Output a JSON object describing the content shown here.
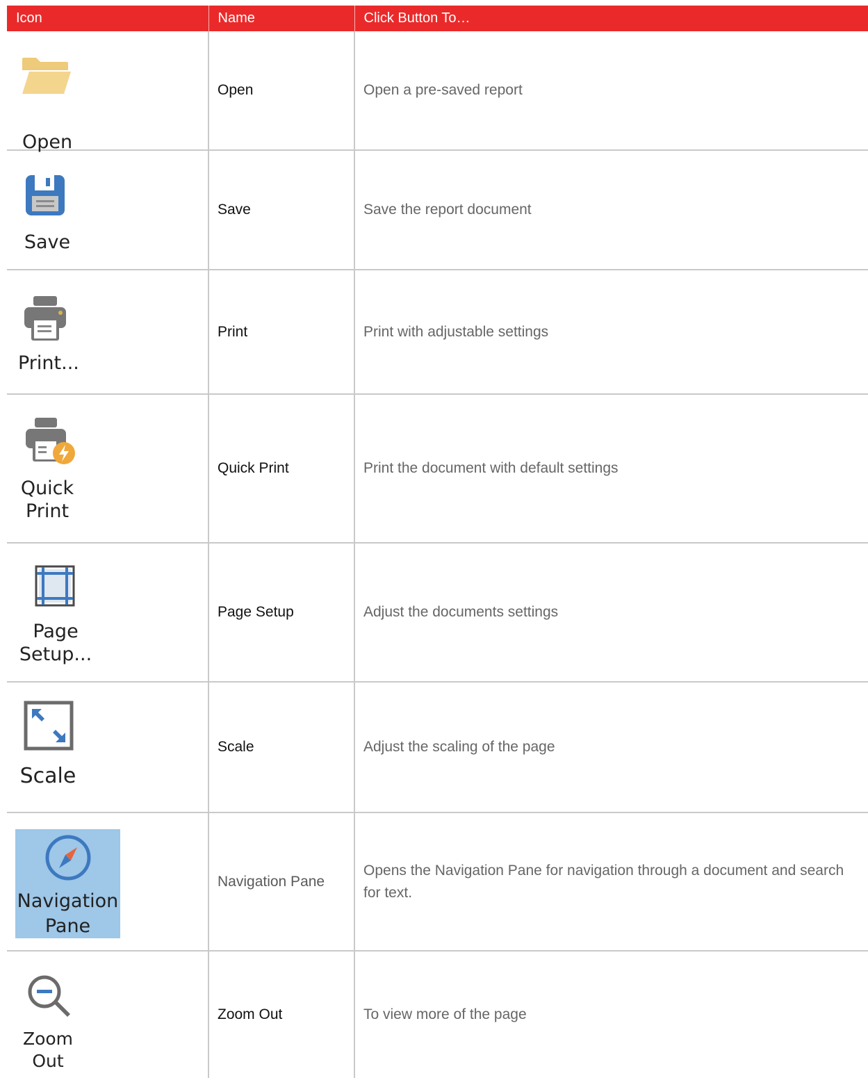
{
  "table": {
    "headers": [
      "Icon",
      "Name",
      "Click Button To…"
    ],
    "rows": [
      {
        "icon": "folder-open-icon",
        "icon_label": "Open",
        "name": "Open",
        "desc": "Open a pre-saved report"
      },
      {
        "icon": "floppy-disk-icon",
        "icon_label": "Save",
        "name": "Save",
        "desc": "Save the report document"
      },
      {
        "icon": "printer-icon",
        "icon_label": "Print...",
        "name": "Print",
        "desc": "Print with adjustable settings"
      },
      {
        "icon": "quick-print-icon",
        "icon_label": "Quick\nPrint",
        "name": "Quick Print",
        "desc": "Print the document with default settings"
      },
      {
        "icon": "page-setup-icon",
        "icon_label": "Page\nSetup...",
        "name": "Page Setup",
        "desc": "Adjust the documents settings"
      },
      {
        "icon": "scale-icon",
        "icon_label": "Scale",
        "name": "Scale",
        "desc": "Adjust the scaling of the page"
      },
      {
        "icon": "compass-icon",
        "icon_label": "Navigation\nPane",
        "name": "Navigation Pane",
        "desc": "Opens the Navigation Pane for navigation through a document and search for text."
      },
      {
        "icon": "zoom-out-icon",
        "icon_label": "Zoom\nOut",
        "name": "Zoom Out",
        "desc": "To view more of the page"
      }
    ]
  },
  "colors": {
    "header_bg": "#ea2a2a",
    "grid_line": "#c9c9c9",
    "nav_highlight": "#9ec7e8",
    "folder": "#f2cf7e",
    "save_blue": "#3d79bf",
    "printer_gray": "#777777",
    "lightning_orange": "#f0a83a",
    "compass_orange": "#e8643c"
  }
}
